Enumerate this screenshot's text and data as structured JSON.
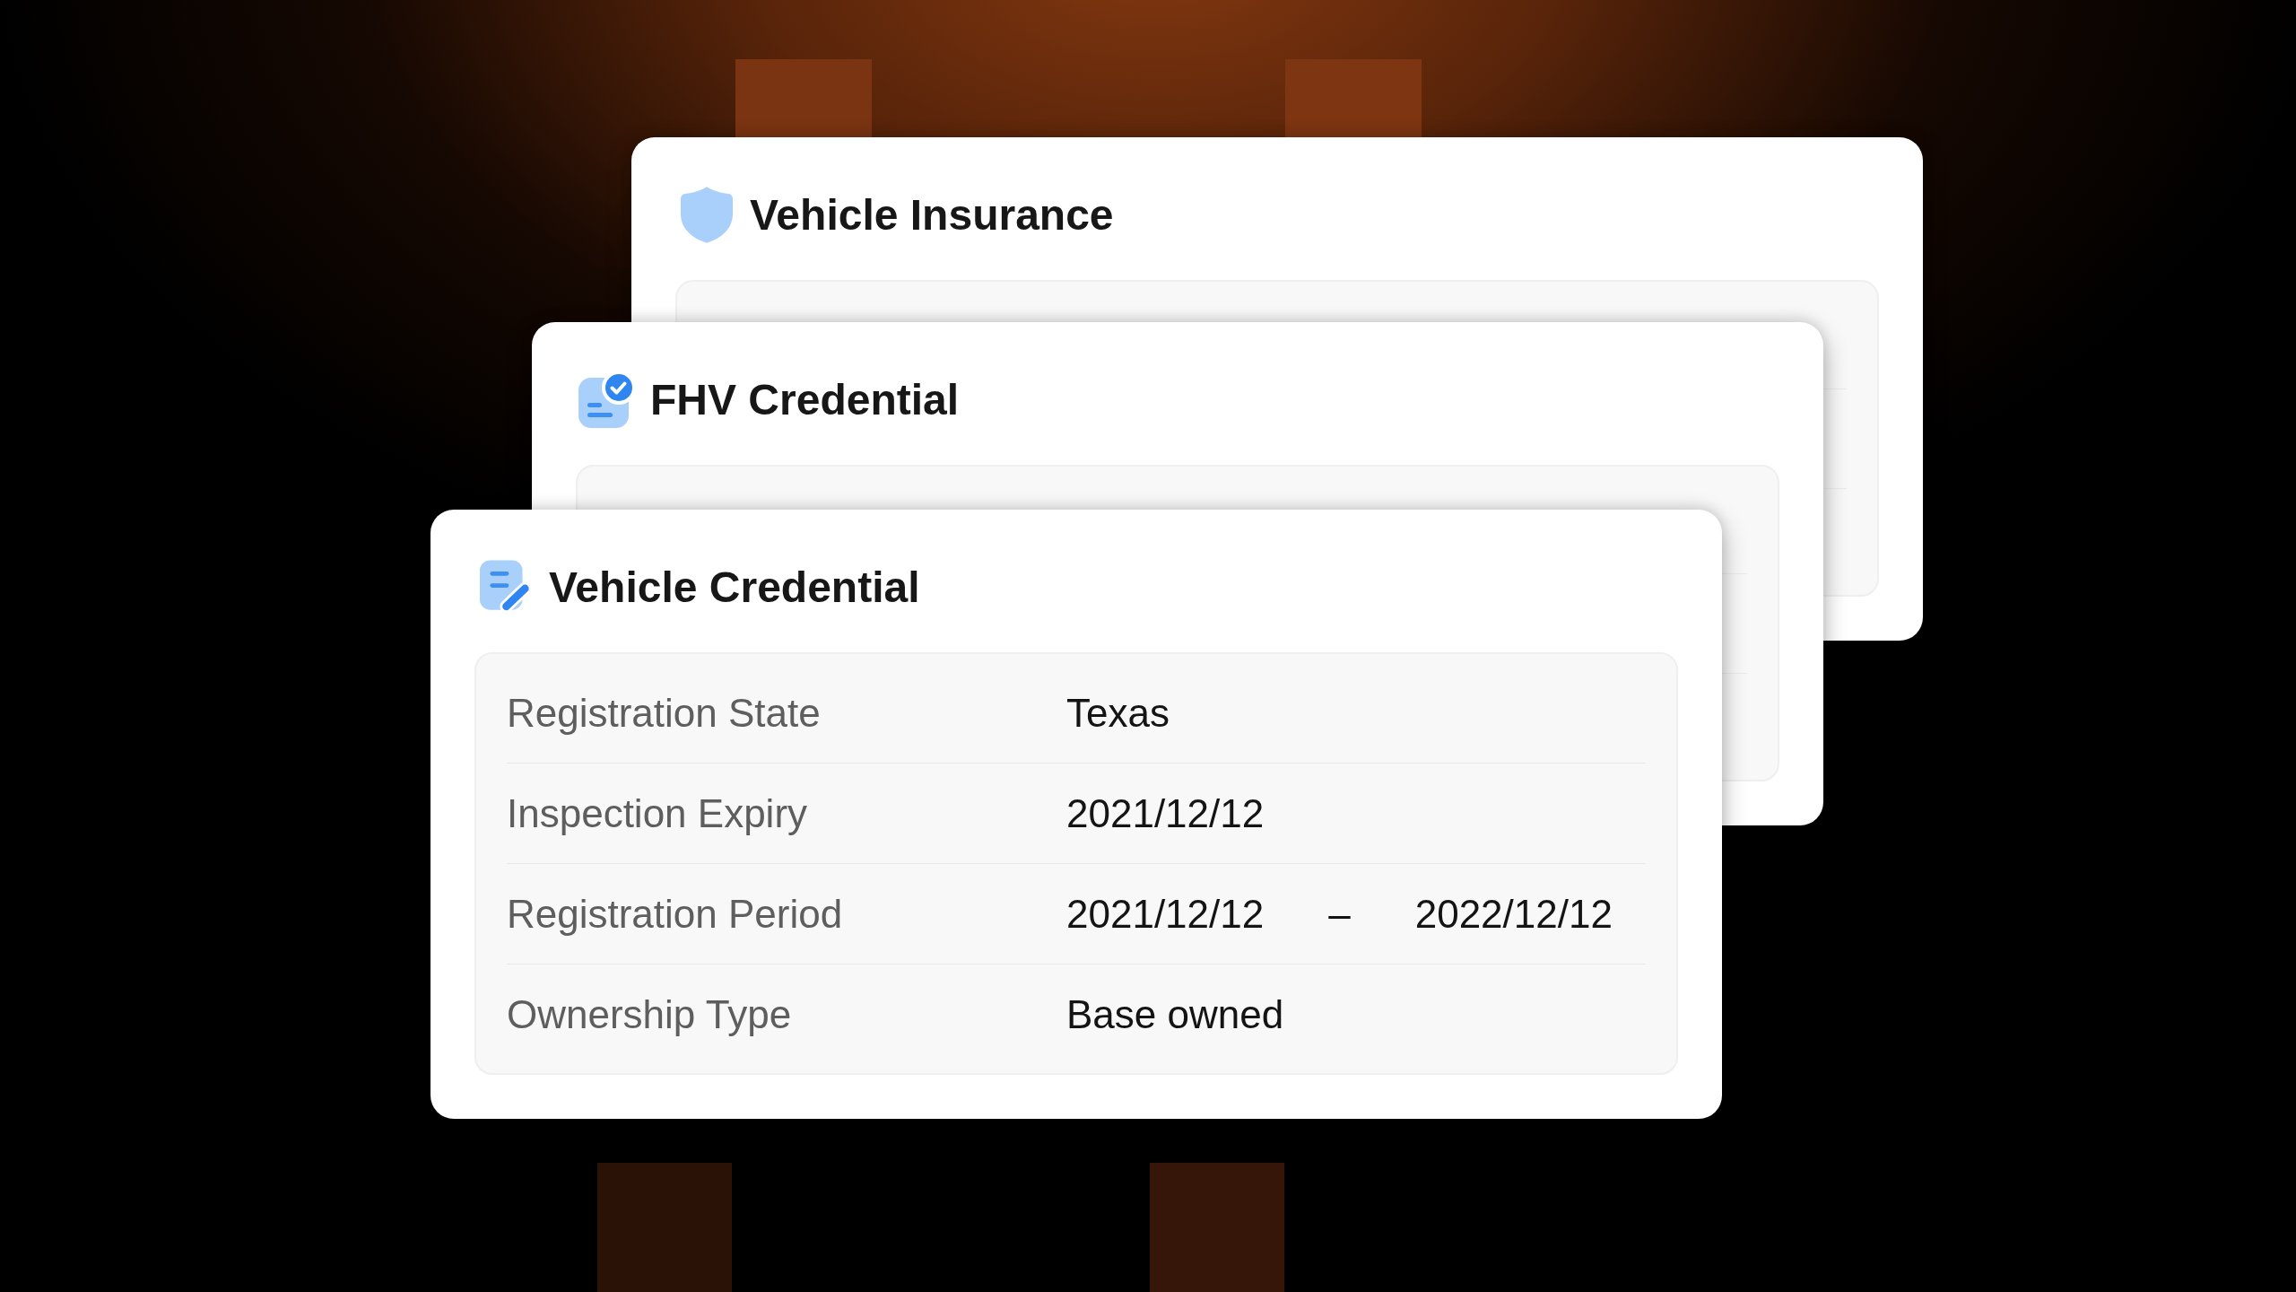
{
  "cards": [
    {
      "title": "Vehicle Insurance"
    },
    {
      "title": "FHV Credential"
    },
    {
      "title": "Vehicle Credential",
      "fields": [
        {
          "kind": "text",
          "label": "Registration State",
          "value": "Texas"
        },
        {
          "kind": "text",
          "label": "Inspection Expiry",
          "value": "2021/12/12"
        },
        {
          "kind": "range",
          "label": "Registration Period",
          "start": "2021/12/12",
          "separator": "–",
          "end": "2022/12/12"
        },
        {
          "kind": "text",
          "label": "Ownership Type",
          "value": "Base owned"
        }
      ]
    }
  ]
}
